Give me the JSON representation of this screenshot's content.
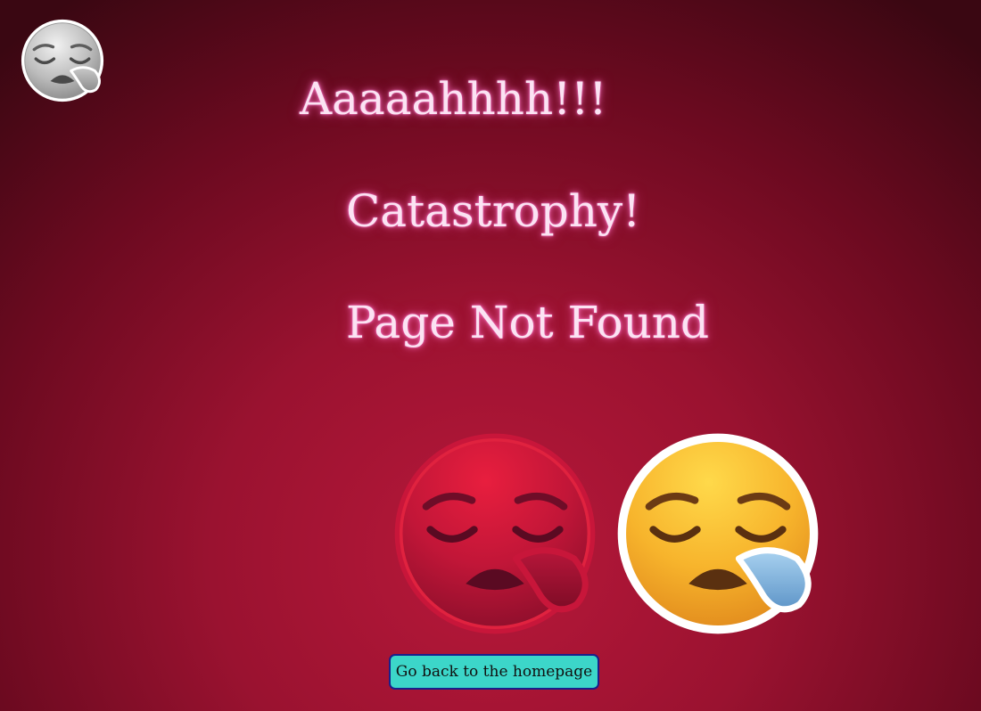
{
  "headings": {
    "line1": "Aaaaahhhh!!!",
    "line2": "Catastrophy!",
    "line3": "Page Not Found"
  },
  "button": {
    "label": "Go back to the homepage"
  },
  "icons": {
    "corner": "sleepy-face-grey-icon",
    "center_left": "sleepy-face-red-icon",
    "center_right": "sleepy-face-yellow-icon"
  },
  "colors": {
    "background": "#9a1230",
    "heading_text": "#fbe3f3",
    "heading_glow": "#ff7fd0",
    "button_bg": "#3cd6c9",
    "button_border": "#1b1f8a"
  }
}
